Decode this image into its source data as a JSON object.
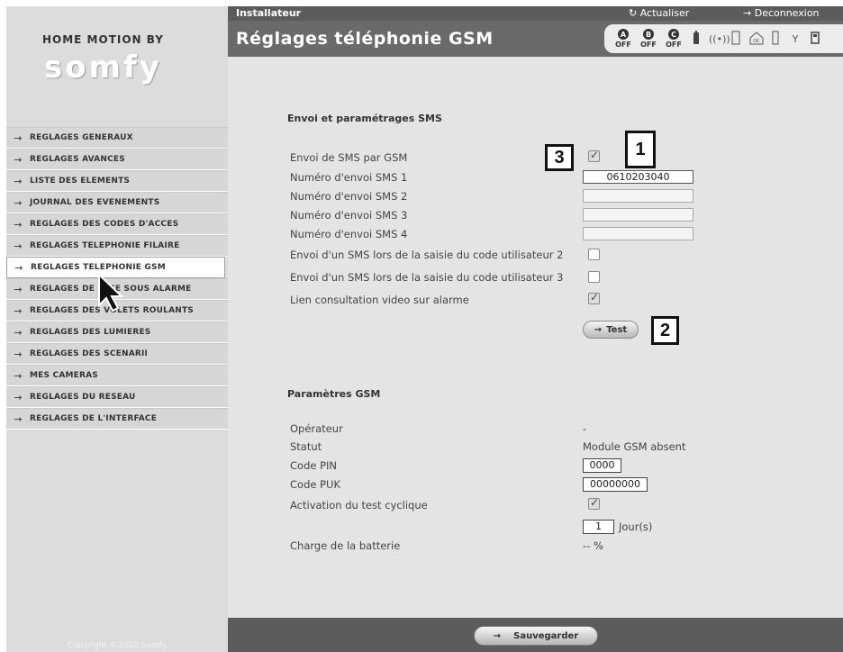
{
  "brand": {
    "top": "HOME MOTION BY",
    "name": "somfy",
    "copyright": "Copyright ©2010 Somfy"
  },
  "topbar": {
    "role": "Installateur",
    "refresh": "Actualiser",
    "logout": "Deconnexion"
  },
  "page_title": "Réglages téléphonie GSM",
  "zones": [
    {
      "letter": "A",
      "state": "OFF"
    },
    {
      "letter": "B",
      "state": "OFF"
    },
    {
      "letter": "C",
      "state": "OFF"
    }
  ],
  "status_icons": [
    "battery-icon",
    "signal-icon",
    "door-icon",
    "home-ok-icon",
    "door-icon",
    "antenna-icon",
    "device-icon"
  ],
  "menu": {
    "arrow": "→",
    "items": [
      {
        "label": "REGLAGES GENERAUX"
      },
      {
        "label": "REGLAGES AVANCES"
      },
      {
        "label": "LISTE DES ELEMENTS"
      },
      {
        "label": "JOURNAL DES EVENEMENTS"
      },
      {
        "label": "REGLAGES DES CODES D'ACCES"
      },
      {
        "label": "REGLAGES TELEPHONIE FILAIRE"
      },
      {
        "label": "REGLAGES TELEPHONIE GSM",
        "active": true
      },
      {
        "label": "REGLAGES DE MISE SOUS ALARME"
      },
      {
        "label": "REGLAGES DES VOLETS ROULANTS"
      },
      {
        "label": "REGLAGES DES LUMIERES"
      },
      {
        "label": "REGLAGES DES SCENARII"
      },
      {
        "label": "MES CAMERAS"
      },
      {
        "label": "REGLAGES DU RESEAU"
      },
      {
        "label": "REGLAGES DE L'INTERFACE"
      }
    ]
  },
  "sms": {
    "title": "Envoi et paramétrages SMS",
    "send_sms_label": "Envoi de SMS par GSM",
    "send_sms_checked": true,
    "number1_label": "Numéro d'envoi SMS 1",
    "number1_value": "0610203040",
    "number2_label": "Numéro d'envoi SMS 2",
    "number2_value": "",
    "number3_label": "Numéro d'envoi SMS 3",
    "number3_value": "",
    "number4_label": "Numéro d'envoi SMS 4",
    "number4_value": "",
    "user2_label": "Envoi d'un SMS lors de la saisie du code utilisateur 2",
    "user2_checked": false,
    "user3_label": "Envoi d'un SMS lors de la saisie du code utilisateur 3",
    "user3_checked": false,
    "video_label": "Lien consultation video sur alarme",
    "video_checked": true,
    "test_button": "Test",
    "button_arrow": "→"
  },
  "gsm": {
    "title": "Paramètres GSM",
    "operator_label": "Opérateur",
    "operator_value": "-",
    "status_label": "Statut",
    "status_value": "Module GSM absent",
    "pin_label": "Code PIN",
    "pin_value": "0000",
    "puk_label": "Code PUK",
    "puk_value": "00000000",
    "cyclic_label": "Activation du test cyclique",
    "cyclic_checked": true,
    "cyclic_days": "1",
    "cyclic_unit": "Jour(s)",
    "battery_label": "Charge de la batterie",
    "battery_value": "-- %"
  },
  "footer": {
    "save_button": "Sauvegarder",
    "button_arrow": "→"
  },
  "callouts": {
    "c1": "1",
    "c2": "2",
    "c3": "3"
  }
}
